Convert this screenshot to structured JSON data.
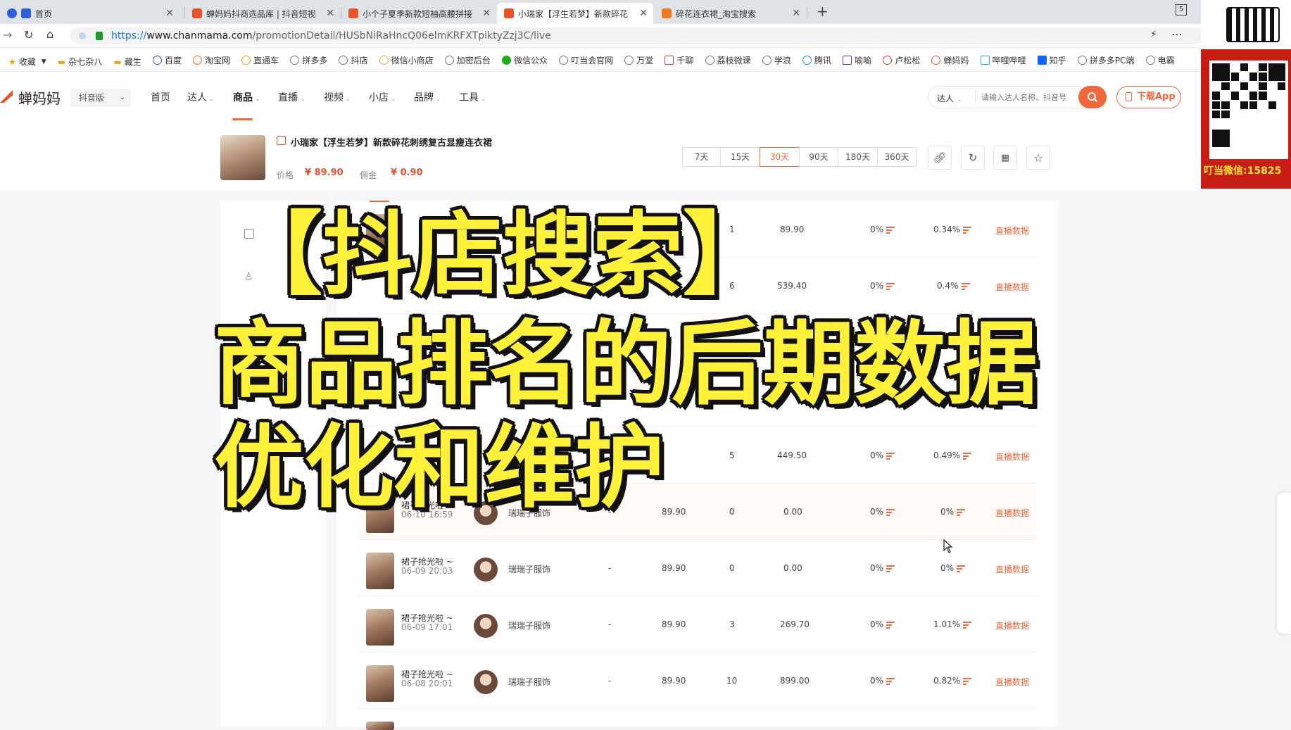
{
  "browser": {
    "tabs": [
      {
        "label": "首页",
        "color": "#2f5fd9"
      },
      {
        "label": "蝉妈妈抖商选品库 | 抖音短视",
        "color": "#e8532b"
      },
      {
        "label": "小个子夏季新款短袖高腰拼接",
        "color": "#e8532b"
      },
      {
        "label": "小瑞家【浮生若梦】新款碎花",
        "color": "#e8532b"
      },
      {
        "label": "碎花连衣裙_淘宝搜索",
        "color": "#f07a1a"
      }
    ],
    "new_tab": "+",
    "tab_count": "5",
    "url_scheme": "https://",
    "url_host": "www.chanmama.com",
    "url_path": "/promotionDetail/HUSbNiRaHncQ06eImKRFXTpiktyZzj3C/live"
  },
  "bookmarks": [
    "收藏",
    "杂七杂八",
    "藏生",
    "百度",
    "淘宝网",
    "直通车",
    "拼多多",
    "抖店",
    "微信小商店",
    "加密后台",
    "微信公众",
    "叮当会官网",
    "万堂",
    "千聊",
    "荔枝微课",
    "学浪",
    "腾讯",
    "喻喻",
    "卢松松",
    "蝉妈妈",
    "哔哩哔哩",
    "知乎",
    "拼多多PC端",
    "电霸"
  ],
  "site": {
    "logo": "蝉妈妈",
    "edition": "抖音版",
    "nav": [
      "首页",
      "达人",
      "商品",
      "直播",
      "视频",
      "小店",
      "品牌",
      "工具"
    ],
    "active_nav": "商品",
    "search_scope": "达人",
    "search_placeholder": "请输入达人名称、抖音号",
    "download": "下载App"
  },
  "product": {
    "title": "小瑞家【浮生若梦】新款碎花刺绣复古显瘦连衣裙",
    "price_label": "价格",
    "price": "¥ 89.90",
    "commission_label": "佣金",
    "commission": "¥ 0.90",
    "periods": [
      "7天",
      "15天",
      "30天",
      "90天",
      "180天",
      "360天"
    ],
    "active_period": "30天"
  },
  "side": {
    "item2": "析"
  },
  "rows": [
    {
      "title": "",
      "time": "",
      "anchor": "",
      "dash": "",
      "price": "",
      "sales": "1",
      "gmv": "89.90",
      "rate1": "0%",
      "rate2": "0.34%",
      "action": "直播数据"
    },
    {
      "title": "",
      "time": "",
      "anchor": "",
      "dash": "",
      "price": "",
      "sales": "6",
      "gmv": "539.40",
      "rate1": "0%",
      "rate2": "0.4%",
      "action": "直播数据"
    },
    {
      "title": "",
      "time": "",
      "anchor": "",
      "dash": "",
      "price": "",
      "sales": "5",
      "gmv": "449.50",
      "rate1": "0%",
      "rate2": "0.49%",
      "action": "直播数据"
    },
    {
      "title": "裙子抢光啦 ~",
      "time": "06-10 16:59",
      "anchor": "瑞瑞子服饰",
      "dash": "-",
      "price": "89.90",
      "sales": "0",
      "gmv": "0.00",
      "rate1": "0%",
      "rate2": "0%",
      "action": "直播数据"
    },
    {
      "title": "裙子抢光啦 ~",
      "time": "06-09 20:03",
      "anchor": "瑞瑞子服饰",
      "dash": "-",
      "price": "89.90",
      "sales": "0",
      "gmv": "0.00",
      "rate1": "0%",
      "rate2": "0%",
      "action": "直播数据"
    },
    {
      "title": "裙子抢光啦 ~",
      "time": "06-09 17:01",
      "anchor": "瑞瑞子服饰",
      "dash": "-",
      "price": "89.90",
      "sales": "3",
      "gmv": "269.70",
      "rate1": "0%",
      "rate2": "1.01%",
      "action": "直播数据"
    },
    {
      "title": "裙子抢光啦 ~",
      "time": "06-08 20:01",
      "anchor": "瑞瑞子服饰",
      "dash": "-",
      "price": "89.90",
      "sales": "10",
      "gmv": "899.00",
      "rate1": "0%",
      "rate2": "0.82%",
      "action": "直播数据"
    }
  ],
  "overlay": {
    "line1": "【抖店搜索】",
    "line2": "商品排名的后期数据",
    "line3": "优化和维护"
  },
  "promo": {
    "wechat": "叮当微信:15825"
  },
  "colors": {
    "accent": "#f0683c",
    "overlay_text": "#fff13a",
    "promo_red": "#c81d14"
  }
}
